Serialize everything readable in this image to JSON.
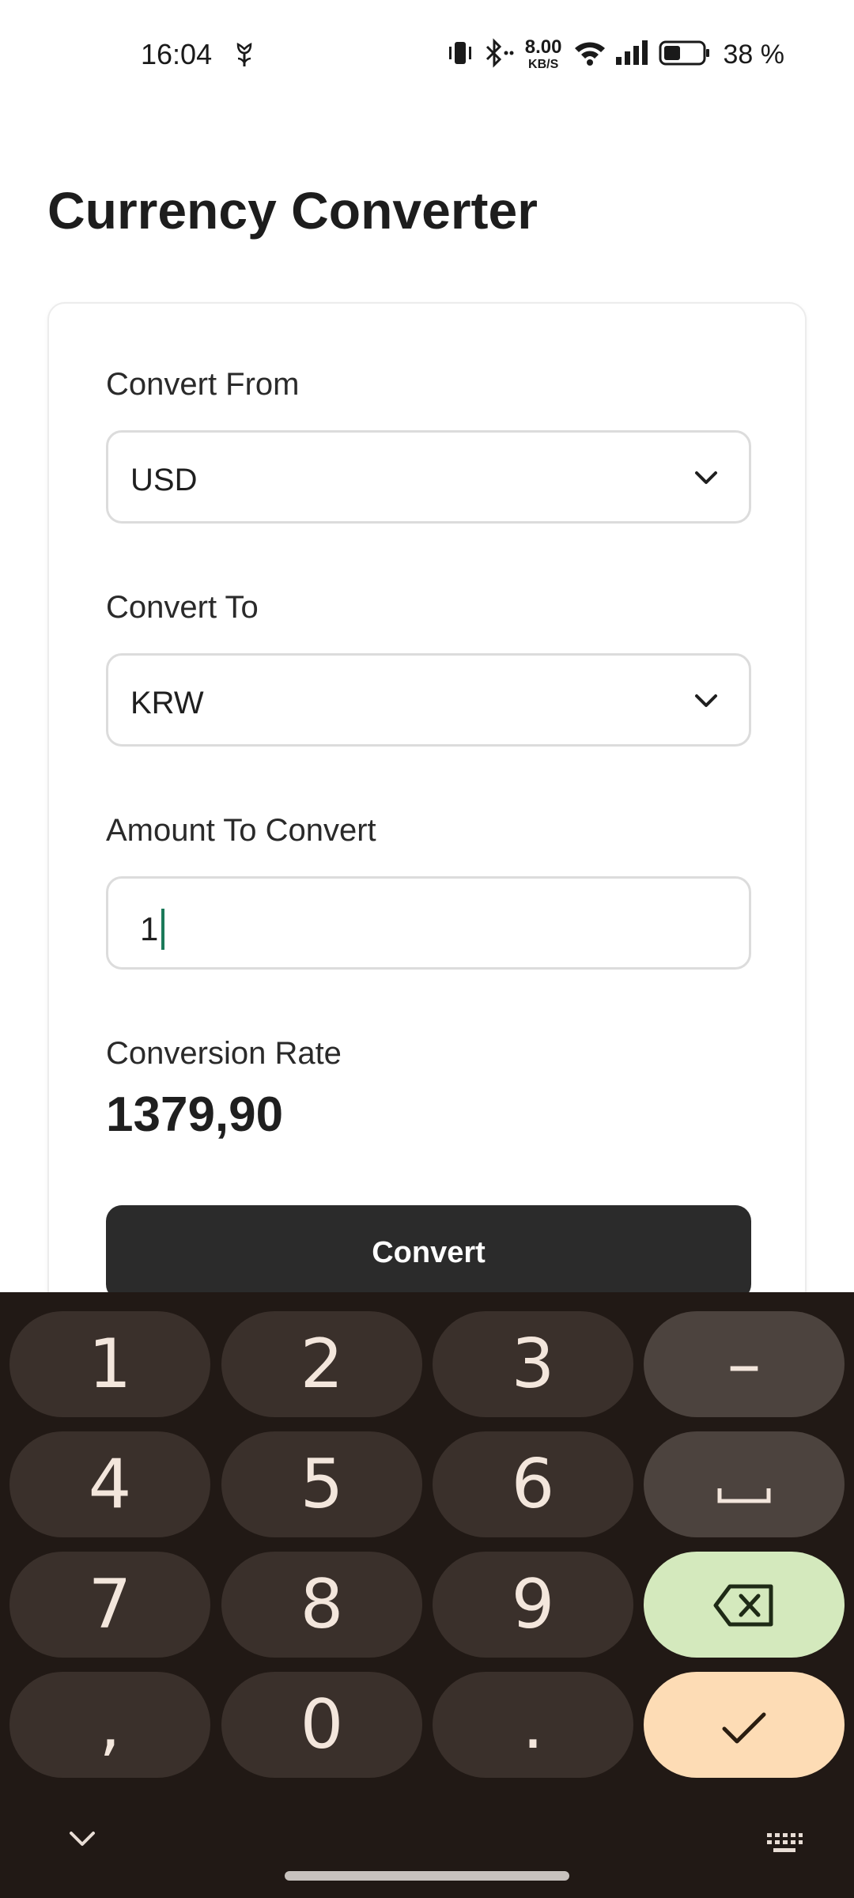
{
  "status_bar": {
    "time": "16:04",
    "net_speed_value": "8.00",
    "net_speed_unit": "KB/S",
    "battery_text": "38 %",
    "icons": [
      "flower-icon",
      "vibrate-icon",
      "bluetooth-icon",
      "wifi-icon",
      "signal-icon",
      "battery-icon"
    ]
  },
  "page": {
    "title": "Currency Converter"
  },
  "form": {
    "from_label": "Convert From",
    "from_value": "USD",
    "to_label": "Convert To",
    "to_value": "KRW",
    "amount_label": "Amount To Convert",
    "amount_value": "1",
    "rate_label": "Conversion Rate",
    "rate_value": "1379,90",
    "convert_label": "Convert"
  },
  "keyboard": {
    "keys": {
      "k1": "1",
      "k2": "2",
      "k3": "3",
      "minus": "–",
      "k4": "4",
      "k5": "5",
      "k6": "6",
      "k7": "7",
      "k8": "8",
      "k9": "9",
      "comma": ",",
      "k0": "0",
      "period": "."
    },
    "icons": [
      "space-icon",
      "backspace-icon",
      "checkmark-icon",
      "collapse-keyboard-icon",
      "keyboard-switch-icon"
    ],
    "colors": {
      "background": "#211915",
      "key": "#3a302b",
      "function_key": "#4c433e",
      "backspace": "#d4e9bd",
      "enter": "#fddcb5"
    }
  }
}
